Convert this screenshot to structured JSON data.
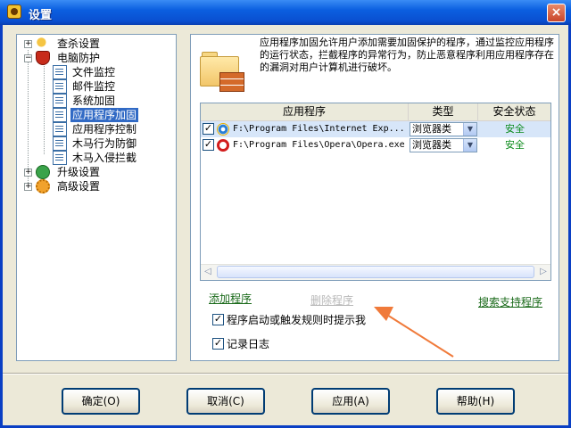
{
  "window": {
    "title": "设置",
    "close_glyph": "×"
  },
  "tree": {
    "items": [
      {
        "label": "查杀设置",
        "level": 0,
        "expander": "+",
        "icon": "key-icon"
      },
      {
        "label": "电脑防护",
        "level": 0,
        "expander": "−",
        "icon": "shield-icon"
      },
      {
        "label": "文件监控",
        "level": 1,
        "icon": "document-icon"
      },
      {
        "label": "邮件监控",
        "level": 1,
        "icon": "document-icon"
      },
      {
        "label": "系统加固",
        "level": 1,
        "icon": "document-icon"
      },
      {
        "label": "应用程序加固",
        "level": 1,
        "icon": "document-icon",
        "selected": true
      },
      {
        "label": "应用程序控制",
        "level": 1,
        "icon": "document-icon"
      },
      {
        "label": "木马行为防御",
        "level": 1,
        "icon": "document-icon"
      },
      {
        "label": "木马入侵拦截",
        "level": 1,
        "icon": "document-icon"
      },
      {
        "label": "升级设置",
        "level": 0,
        "expander": "+",
        "icon": "upgrade-icon"
      },
      {
        "label": "高级设置",
        "level": 0,
        "expander": "+",
        "icon": "gear-icon"
      }
    ]
  },
  "panel": {
    "description": "应用程序加固允许用户添加需要加固保护的程序，通过监控应用程序的运行状态，拦截程序的异常行为，防止恶意程序利用应用程序存在的漏洞对用户计算机进行破坏。",
    "table": {
      "headers": [
        "应用程序",
        "类型",
        "安全状态"
      ],
      "rows": [
        {
          "checked": true,
          "icon": "ie-icon",
          "path": "F:\\Program Files\\Internet Exp...",
          "type": "浏览器类",
          "status": "安全",
          "selected": true
        },
        {
          "checked": true,
          "icon": "opera-icon",
          "path": "F:\\Program Files\\Opera\\Opera.exe",
          "type": "浏览器类",
          "status": "安全",
          "selected": false
        }
      ]
    },
    "add_link": "添加程序",
    "delete_link": "删除程序",
    "search_link": "搜索支持程序",
    "options": [
      {
        "label": "程序启动或触发规则时提示我",
        "checked": true
      },
      {
        "label": "记录日志",
        "checked": true
      }
    ]
  },
  "buttons": {
    "ok": "确定(O)",
    "cancel": "取消(C)",
    "apply": "应用(A)",
    "help": "帮助(H)"
  },
  "colors": {
    "accent": "#316ac5",
    "status_safe": "#0a8a1a",
    "annotation_arrow": "#f07a3a"
  }
}
